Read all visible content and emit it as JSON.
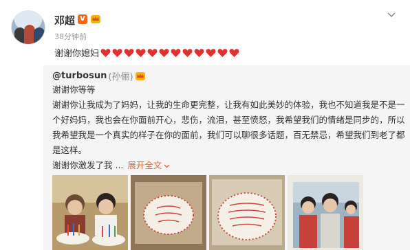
{
  "post": {
    "username": "邓超",
    "verified_badge": "V",
    "timestamp": "38分钟前",
    "text": "谢谢你媳妇",
    "heart_count": 12,
    "heart_color": "#e1312e"
  },
  "repost": {
    "username": "@turbosun",
    "realname": "(孙俪)",
    "lines": [
      "谢谢你等等",
      "谢谢你让我成为了妈妈，让我的生命更完整，让我有如此美妙的体验，我也不知道我是不是一",
      "个好妈妈，我也会在你面前开心，悲伤，流泪，甚至愤怒，我希望我们的情绪是同步的，所以",
      "我希望我是一个真实的样子在你的面前，我们可以聊很多话题，百无禁忌，希望我们到老了都",
      "是这样。",
      "谢谢你激发了我 ..."
    ],
    "expand_label": "展开全文",
    "images": [
      "childhood-photo",
      "birthday-cake-1",
      "birthday-cake-2",
      "family-photo"
    ]
  },
  "colors": {
    "accent": "#e0693e",
    "verified": "#f26b1d",
    "background": "#f5f5f5"
  }
}
